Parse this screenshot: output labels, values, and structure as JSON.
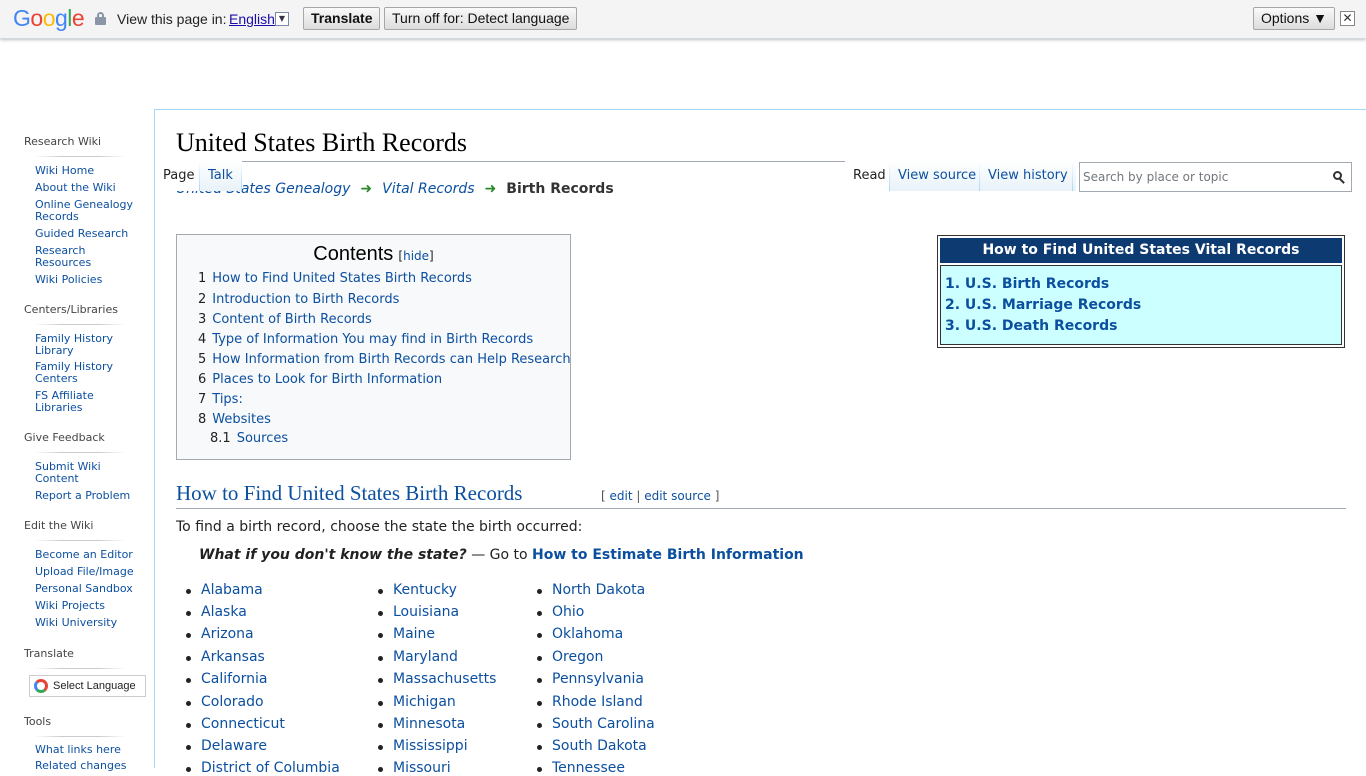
{
  "translate_bar": {
    "view_label": "View this page in:",
    "language": "English",
    "translate_button": "Translate",
    "turn_off_button": "Turn off for: Detect language",
    "options_button": "Options ▼",
    "close": "✕"
  },
  "sidebar": {
    "sections": [
      {
        "heading": "Research Wiki",
        "items": [
          "Wiki Home",
          "About the Wiki",
          "Online Genealogy Records",
          "Guided Research",
          "Research Resources",
          "Wiki Policies"
        ]
      },
      {
        "heading": "Centers/Libraries",
        "items": [
          "Family History Library",
          "Family History Centers",
          "FS Affiliate Libraries"
        ]
      },
      {
        "heading": "Give Feedback",
        "items": [
          "Submit Wiki Content",
          "Report a Problem"
        ]
      },
      {
        "heading": "Edit the Wiki",
        "items": [
          "Become an Editor",
          "Upload File/Image",
          "Personal Sandbox",
          "Wiki Projects",
          "Wiki University"
        ]
      },
      {
        "heading": "Translate",
        "items": []
      },
      {
        "heading": "Tools",
        "items": [
          "What links here",
          "Related changes"
        ]
      }
    ],
    "select_language": "Select Language"
  },
  "tabs": {
    "page": "Page",
    "talk": "Talk",
    "read": "Read",
    "view_source": "View source",
    "view_history": "View history"
  },
  "search": {
    "placeholder": "Search by place or topic"
  },
  "page_title": "United States Birth Records",
  "breadcrumbs": [
    "United States Genealogy",
    "Vital Records",
    "Birth Records"
  ],
  "toc": {
    "title": "Contents",
    "hide": "hide",
    "items": [
      {
        "num": "1",
        "label": "How to Find United States Birth Records"
      },
      {
        "num": "2",
        "label": "Introduction to Birth Records"
      },
      {
        "num": "3",
        "label": "Content of Birth Records"
      },
      {
        "num": "4",
        "label": "Type of Information You may find in Birth Records"
      },
      {
        "num": "5",
        "label": "How Information from Birth Records can Help Research"
      },
      {
        "num": "6",
        "label": "Places to Look for Birth Information"
      },
      {
        "num": "7",
        "label": "Tips:"
      },
      {
        "num": "8",
        "label": "Websites"
      },
      {
        "num": "8.1",
        "label": "Sources"
      }
    ]
  },
  "vital_box": {
    "title": "How to Find United States Vital Records",
    "items": [
      "1. U.S. Birth Records",
      "2. U.S. Marriage Records",
      "3. U.S. Death Records"
    ]
  },
  "section": {
    "heading": "How to Find United States Birth Records",
    "edit": "edit",
    "edit_source": "edit source",
    "intro": "To find a birth record, choose the state the birth occurred:",
    "whatif_q": "What if you don't know the state?",
    "whatif_sep": " — Go to ",
    "whatif_link": "How to Estimate Birth Information"
  },
  "states": {
    "col1": [
      "Alabama",
      "Alaska",
      "Arizona",
      "Arkansas",
      "California",
      "Colorado",
      "Connecticut",
      "Delaware",
      "District of Columbia"
    ],
    "col2": [
      "Kentucky",
      "Louisiana",
      "Maine",
      "Maryland",
      "Massachusetts",
      "Michigan",
      "Minnesota",
      "Mississippi",
      "Missouri"
    ],
    "col3": [
      "North Dakota",
      "Ohio",
      "Oklahoma",
      "Oregon",
      "Pennsylvania",
      "Rhode Island",
      "South Carolina",
      "South Dakota",
      "Tennessee"
    ]
  }
}
